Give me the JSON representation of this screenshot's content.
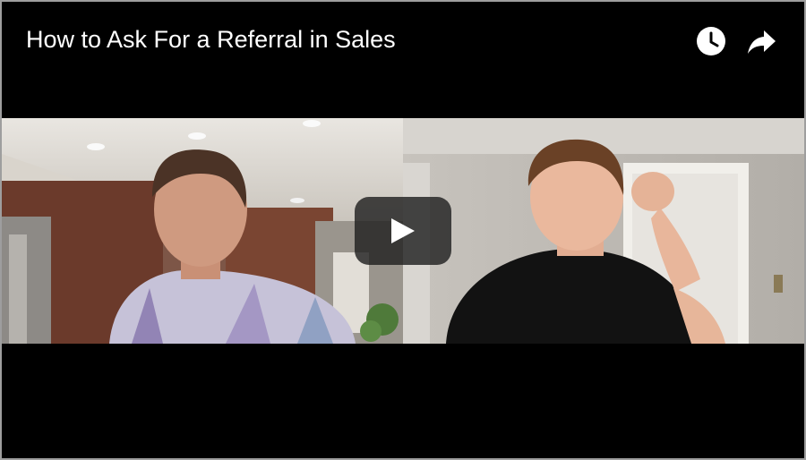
{
  "player": {
    "title": "How to Ask For a Referral in Sales",
    "icons": {
      "watch_later": "clock-icon",
      "share": "share-arrow-icon",
      "play": "play-icon"
    },
    "colors": {
      "background": "#000000",
      "text": "#ffffff",
      "play_button": "#212121"
    }
  }
}
